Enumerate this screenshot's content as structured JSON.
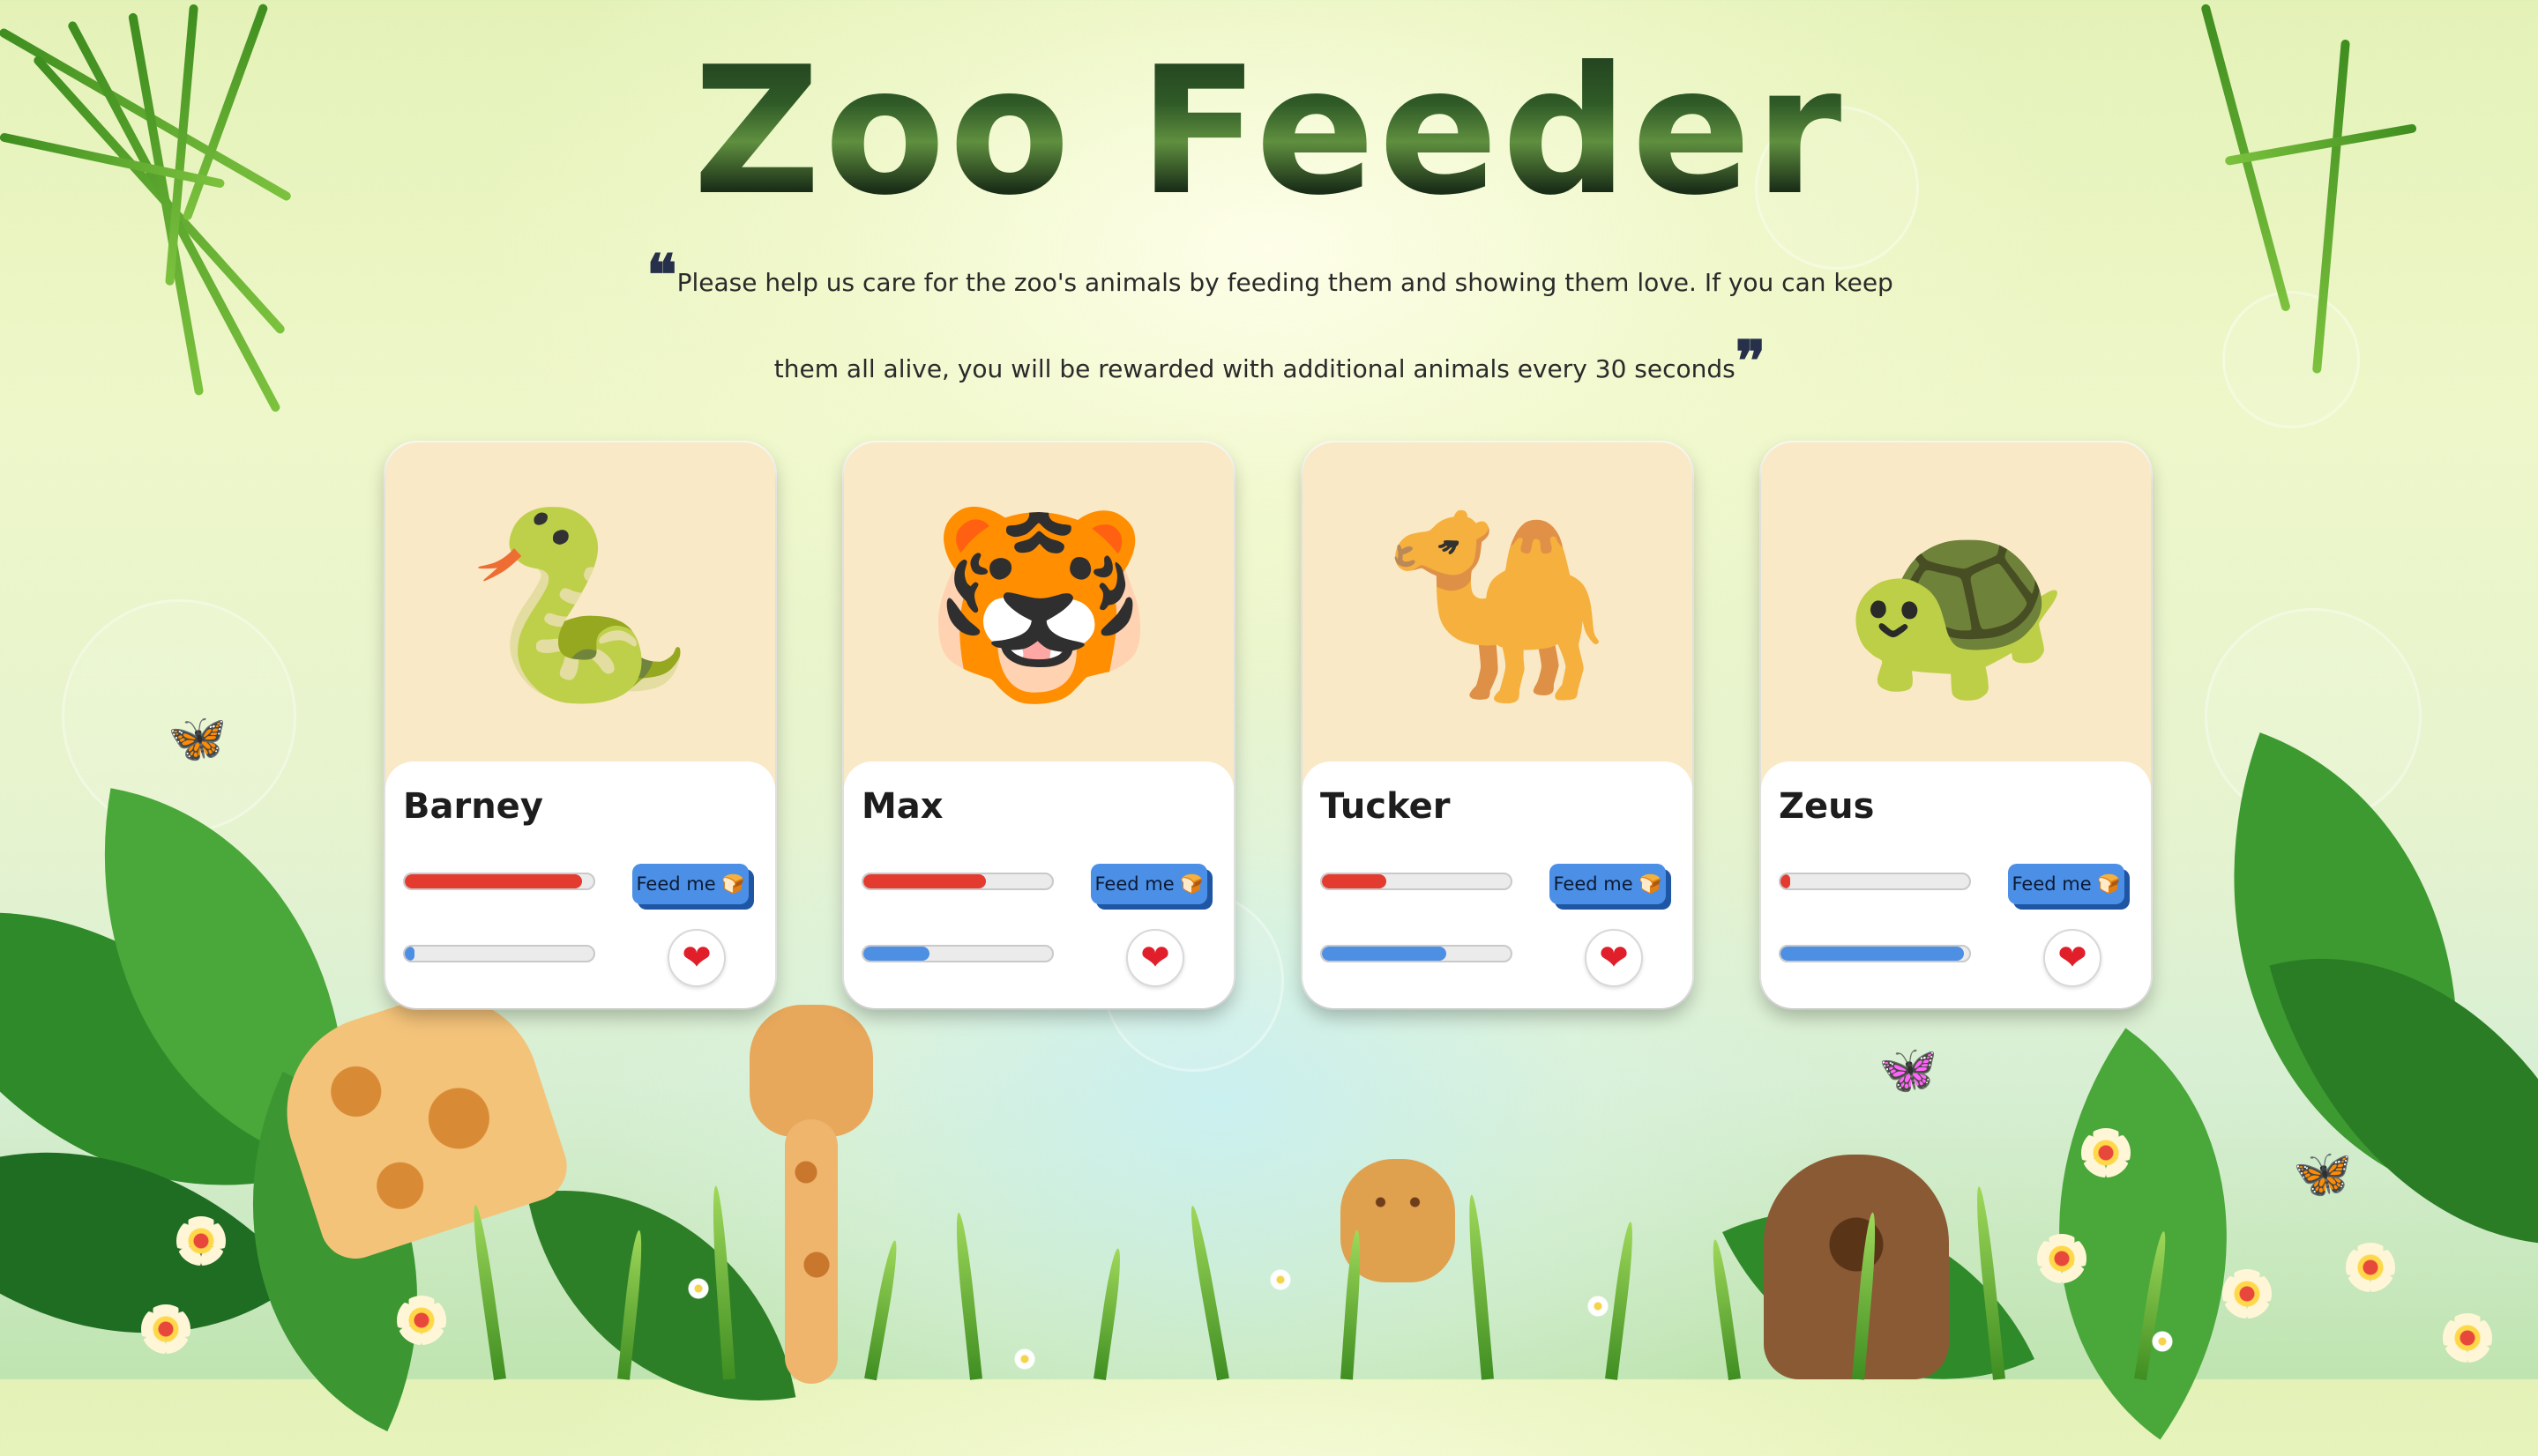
{
  "header": {
    "title": "Zoo Feeder",
    "open_quote": "❝",
    "close_quote": "❞",
    "description_line1": "Please help us care for the zoo's animals by feeding them and showing them love. If you can keep",
    "description_line2": "them all alive, you will be rewarded with additional animals every 30 seconds"
  },
  "animals": [
    {
      "name": "Barney",
      "emoji": "🐍",
      "icon": "snake-icon",
      "hunger_level": 0.94,
      "love_level": 0.05,
      "feed_label": "Feed me 🍞",
      "love_symbol": "❤"
    },
    {
      "name": "Max",
      "emoji": "🐯",
      "icon": "tiger-icon",
      "hunger_level": 0.65,
      "love_level": 0.35,
      "feed_label": "Feed me 🍞",
      "love_symbol": "❤"
    },
    {
      "name": "Tucker",
      "emoji": "🐪",
      "icon": "camel-icon",
      "hunger_level": 0.34,
      "love_level": 0.66,
      "feed_label": "Feed me 🍞",
      "love_symbol": "❤"
    },
    {
      "name": "Zeus",
      "emoji": "🐢",
      "icon": "turtle-icon",
      "hunger_level": 0.05,
      "love_level": 0.97,
      "feed_label": "Feed me 🍞",
      "love_symbol": "❤"
    }
  ],
  "scenery": {
    "animals_in_background": [
      "giraffe",
      "giraffe",
      "cheetah",
      "bear"
    ],
    "butterflies": [
      "🦋",
      "🦋",
      "🦋"
    ],
    "colors": {
      "card_top": "#fae9c6",
      "hunger_bar": "#e33b2f",
      "love_bar": "#4d8fe3",
      "feed_button": "#4b8fe6",
      "feed_button_shadow": "#1f56a4"
    }
  }
}
